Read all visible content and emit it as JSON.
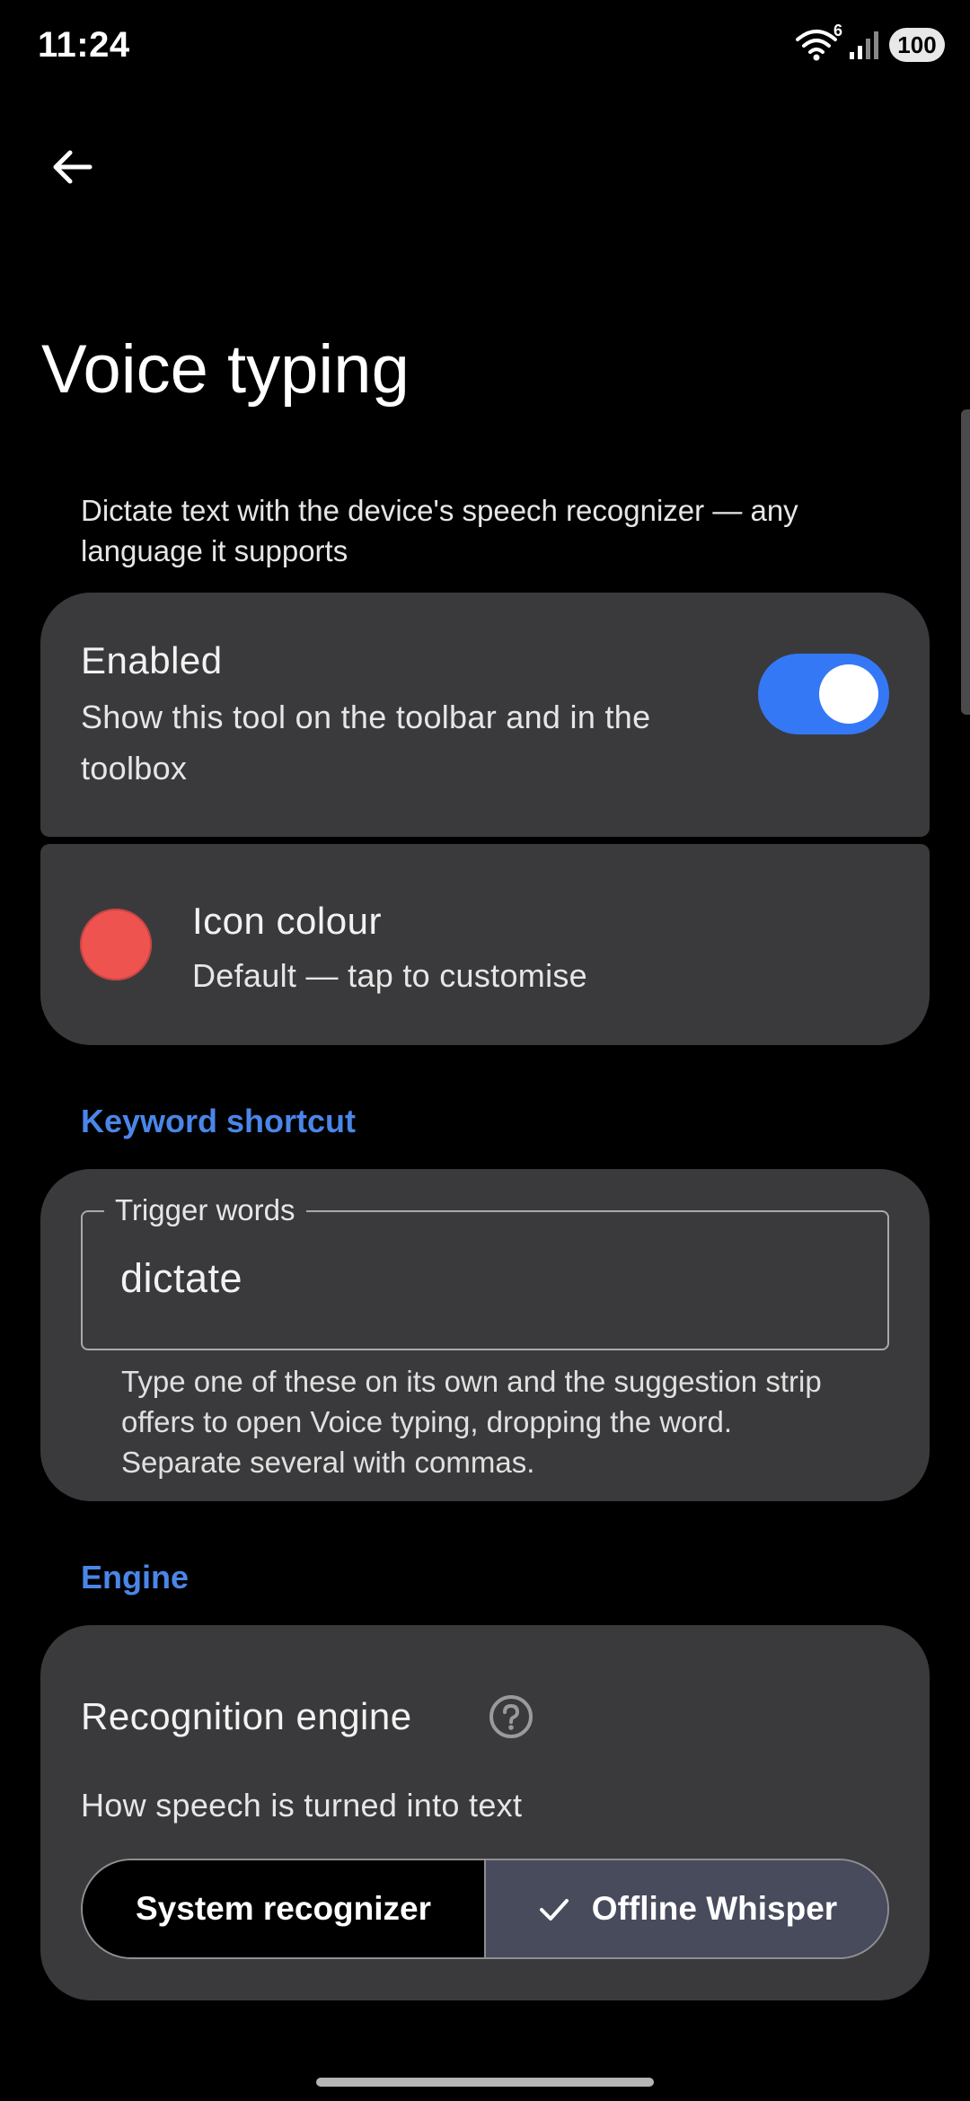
{
  "status_bar": {
    "time": "11:24",
    "network_badge": "6",
    "battery": "100"
  },
  "header": {
    "back_icon": "arrow-left-icon",
    "title": "Voice typing"
  },
  "description": "Dictate text with the device's speech recognizer — any language it supports",
  "enabled": {
    "title": "Enabled",
    "subtitle": "Show this tool on the toolbar and in the toolbox",
    "toggle_on": true
  },
  "icon_colour": {
    "title": "Icon colour",
    "subtitle": "Default — tap to customise",
    "swatch_color": "#ef5350"
  },
  "keyword_section": {
    "header": "Keyword shortcut",
    "field_label": "Trigger words",
    "field_value": "dictate",
    "help_text": "Type one of these on its own and the suggestion strip offers to open Voice typing, dropping the word. Separate several with commas."
  },
  "engine_section": {
    "header": "Engine",
    "title": "Recognition engine",
    "help_icon": "help-circle-icon",
    "subtitle": "How speech is turned into text",
    "options": [
      {
        "label": "System recognizer",
        "selected": false
      },
      {
        "label": "Offline Whisper",
        "selected": true
      }
    ]
  },
  "colors": {
    "accent": "#3478f6",
    "section_header": "#4a86e8",
    "card_background": "#3a3a3c",
    "selected_segment": "#474b5c"
  }
}
